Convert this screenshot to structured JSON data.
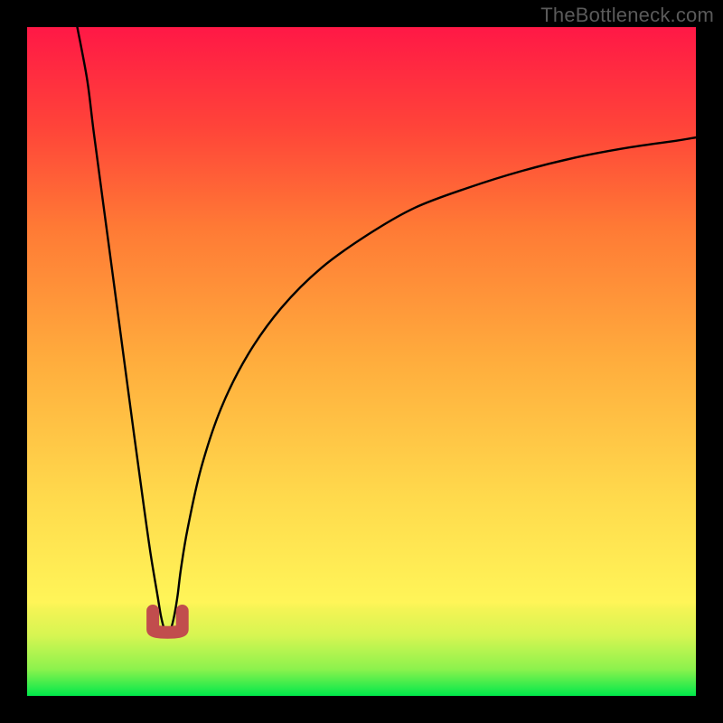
{
  "watermark": "TheBottleneck.com",
  "chart_data": {
    "type": "line",
    "title": "",
    "xlabel": "",
    "ylabel": "",
    "xlim": [
      0,
      100
    ],
    "ylim": [
      0,
      100
    ],
    "grid": false,
    "legend": false,
    "description": "V-shaped bottleneck curve on vertical green-yellow-red gradient background; minimum near x≈21 at y≈9; curve rises steeply left toward y=100 and asymptotically right toward y≈83.",
    "gradient_stops": [
      {
        "offset": 0.0,
        "color": "#00e84b"
      },
      {
        "offset": 0.04,
        "color": "#8cf24d"
      },
      {
        "offset": 0.09,
        "color": "#d6f552"
      },
      {
        "offset": 0.13,
        "color": "#f4f455"
      },
      {
        "offset": 0.14,
        "color": "#fff558"
      },
      {
        "offset": 0.3,
        "color": "#ffd94c"
      },
      {
        "offset": 0.5,
        "color": "#ffad3d"
      },
      {
        "offset": 0.7,
        "color": "#ff7a35"
      },
      {
        "offset": 0.85,
        "color": "#ff4439"
      },
      {
        "offset": 1.0,
        "color": "#ff1846"
      }
    ],
    "series": [
      {
        "name": "bottleneck-curve",
        "color": "#000000",
        "x": [
          7.5,
          9,
          10,
          12,
          14,
          16,
          17.5,
          18.5,
          19.5,
          20,
          20.5,
          21,
          21.5,
          22,
          22.5,
          23,
          24,
          26,
          29,
          33,
          38,
          44,
          51,
          58,
          66,
          74,
          82,
          90,
          97,
          100
        ],
        "y": [
          100,
          92,
          84,
          69,
          54,
          39,
          28,
          21,
          15,
          12,
          10,
          9,
          10,
          12,
          15,
          19,
          25,
          34,
          43,
          51,
          58,
          64,
          69,
          73,
          76,
          78.5,
          80.5,
          82,
          83,
          83.5
        ]
      }
    ],
    "marker": {
      "name": "min-marker",
      "color": "#c14d4d",
      "shape": "U",
      "x_center": 21,
      "y_center": 9.5,
      "half_width": 2.2,
      "height": 3.2,
      "stroke_width": 14
    }
  }
}
